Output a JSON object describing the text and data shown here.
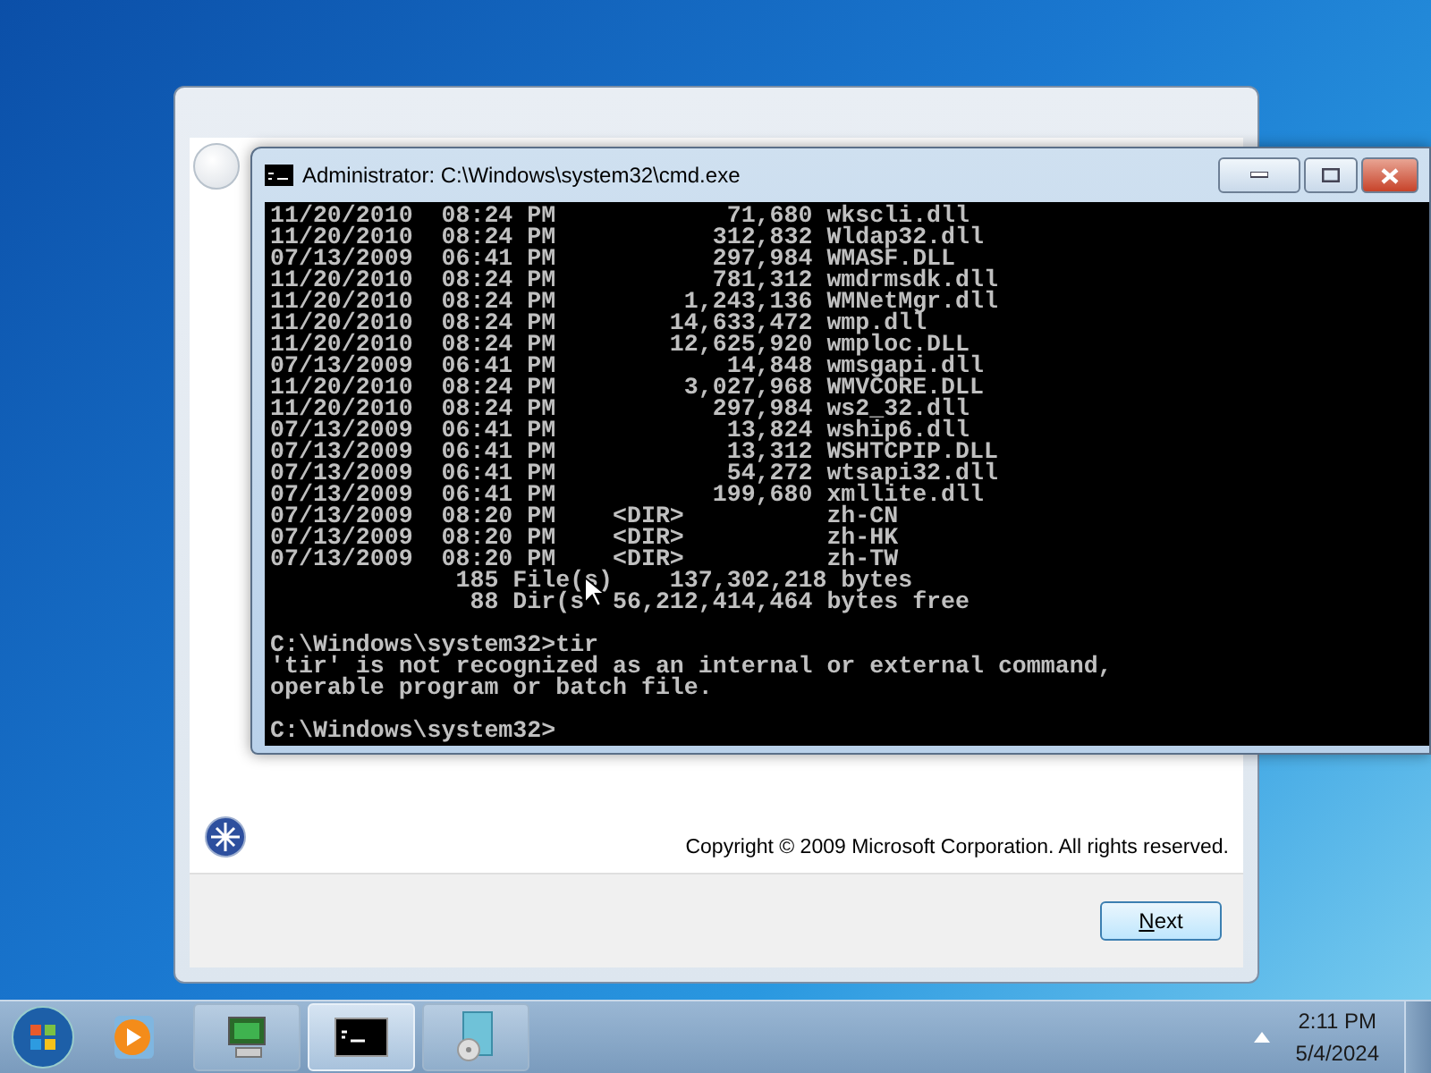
{
  "setup_window": {
    "copyright": "Copyright © 2009 Microsoft Corporation.  All rights reserved.",
    "next_button": "Next"
  },
  "cmd_window": {
    "title": "Administrator: C:\\Windows\\system32\\cmd.exe",
    "console_blocks": [
      [
        "11/20/2010  08:24 PM            71,680 wkscli.dll",
        "11/20/2010  08:24 PM           312,832 Wldap32.dll",
        "07/13/2009  06:41 PM           297,984 WMASF.DLL",
        "11/20/2010  08:24 PM           781,312 wmdrmsdk.dll",
        "11/20/2010  08:24 PM         1,243,136 WMNetMgr.dll",
        "11/20/2010  08:24 PM        14,633,472 wmp.dll",
        "11/20/2010  08:24 PM        12,625,920 wmploc.DLL",
        "07/13/2009  06:41 PM            14,848 wmsgapi.dll",
        "11/20/2010  08:24 PM         3,027,968 WMVCORE.DLL",
        "11/20/2010  08:24 PM           297,984 ws2_32.dll",
        "07/13/2009  06:41 PM            13,824 wship6.dll",
        "07/13/2009  06:41 PM            13,312 WSHTCPIP.DLL",
        "07/13/2009  06:41 PM            54,272 wtsapi32.dll",
        "07/13/2009  06:41 PM           199,680 xmllite.dll",
        "07/13/2009  08:20 PM    <DIR>          zh-CN",
        "07/13/2009  08:20 PM    <DIR>          zh-HK",
        "07/13/2009  08:20 PM    <DIR>          zh-TW",
        "             185 File(s)    137,302,218 bytes",
        "              88 Dir(s  56,212,414,464 bytes free"
      ],
      [
        "C:\\Windows\\system32>tir",
        "'tir' is not recognized as an internal or external command,",
        "operable program or batch file."
      ],
      [
        "C:\\Windows\\system32>"
      ]
    ]
  },
  "taskbar": {
    "buttons": [
      {
        "kind": "setup",
        "selected": false
      },
      {
        "kind": "cmd",
        "selected": true
      },
      {
        "kind": "disc",
        "selected": false
      }
    ],
    "clock_time": "2:11 PM",
    "clock_date": "5/4/2024"
  }
}
